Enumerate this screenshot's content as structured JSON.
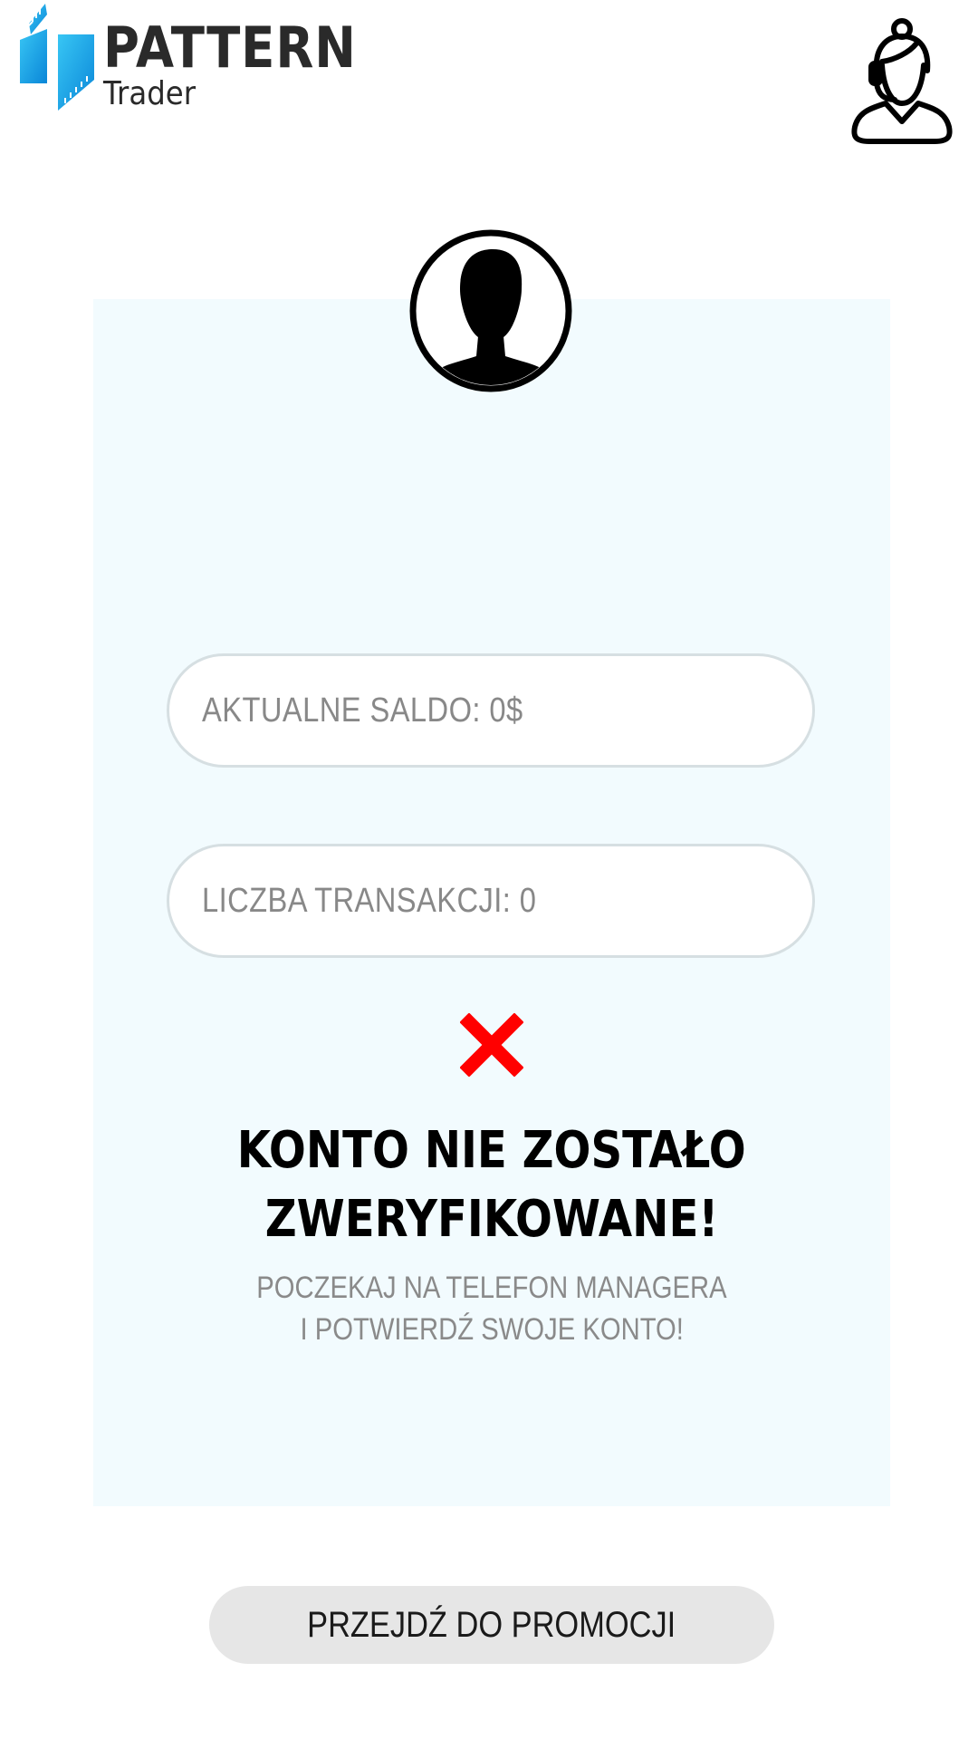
{
  "brand": {
    "name": "PATTERN",
    "tagline": "Trader",
    "logo_icon": "pattern-logo-mark",
    "colors": {
      "accent": "#1aa8e8",
      "text": "#2a2a2a"
    }
  },
  "header": {
    "support_icon": "support-agent-icon"
  },
  "profile": {
    "avatar_icon": "user-avatar-icon"
  },
  "stats": {
    "balance_label": "AKTUALNE SALDO: 0$",
    "transactions_label": "LICZBA TRANSAKCJI: 0"
  },
  "status": {
    "icon": "close-icon",
    "icon_color": "#ff0000",
    "title_line1": "KONTO NIE ZOSTAŁO",
    "title_line2": "ZWERYFIKOWANE!",
    "message_line1": "POCZEKAJ NA TELEFON MANAGERA",
    "message_line2": "I POTWIERDŹ SWOJE KONTO!"
  },
  "actions": {
    "promo_label": "PRZEJDŹ DO PROMOCJI"
  }
}
